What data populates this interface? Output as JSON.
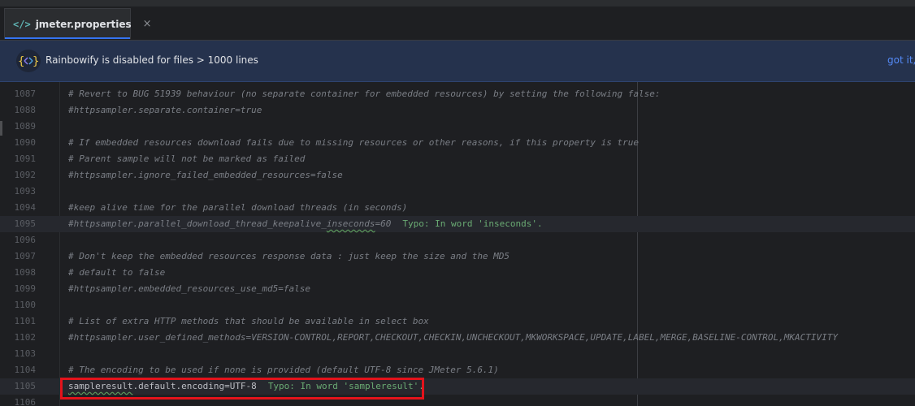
{
  "tab": {
    "label": "jmeter.properties",
    "icon": "code-tags-icon",
    "close": "×"
  },
  "banner": {
    "text": "Rainbowify is disabled for files > 1000 lines",
    "link": "got it,"
  },
  "lines": [
    {
      "num": "1087",
      "text": "# Revert to BUG 51939 behaviour (no separate container for embedded resources) by setting the following false:"
    },
    {
      "num": "1088",
      "text": "#httpsampler.separate.container=true"
    },
    {
      "num": "1089",
      "text": ""
    },
    {
      "num": "1090",
      "text": "# If embedded resources download fails due to missing resources or other reasons, if this property is true"
    },
    {
      "num": "1091",
      "text": "# Parent sample will not be marked as failed"
    },
    {
      "num": "1092",
      "text": "#httpsampler.ignore_failed_embedded_resources=false"
    },
    {
      "num": "1093",
      "text": ""
    },
    {
      "num": "1094",
      "text": "#keep alive time for the parallel download threads (in seconds)"
    },
    {
      "num": "1095",
      "text_pre": "#httpsampler.parallel_download_thread_keepalive_",
      "text_typo": "inseconds",
      "text_post": "=60",
      "hint": "Typo: In word 'inseconds'."
    },
    {
      "num": "1096",
      "text": ""
    },
    {
      "num": "1097",
      "text": "# Don't keep the embedded resources response data : just keep the size and the MD5"
    },
    {
      "num": "1098",
      "text": "# default to false"
    },
    {
      "num": "1099",
      "text": "#httpsampler.embedded_resources_use_md5=false"
    },
    {
      "num": "1100",
      "text": ""
    },
    {
      "num": "1101",
      "text": "# List of extra HTTP methods that should be available in select box"
    },
    {
      "num": "1102",
      "text": "#httpsampler.user_defined_methods=VERSION-CONTROL,REPORT,CHECKOUT,CHECKIN,UNCHECKOUT,MKWORKSPACE,UPDATE,LABEL,MERGE,BASELINE-CONTROL,MKACTIVITY"
    },
    {
      "num": "1103",
      "text": ""
    },
    {
      "num": "1104",
      "text": "# The encoding to be used if none is provided (default UTF-8 since JMeter 5.6.1)"
    },
    {
      "num": "1105",
      "text_typo": "sampleresult",
      "text_post": ".default.encoding=UTF-8",
      "hint": "Typo: In word 'sampleresult'."
    },
    {
      "num": "1106",
      "text": ""
    }
  ]
}
